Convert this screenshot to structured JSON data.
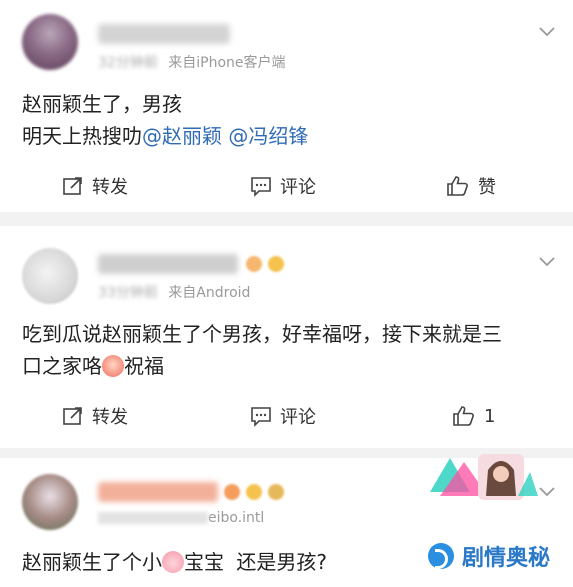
{
  "posts": [
    {
      "time": "32分钟前",
      "source": "来自iPhone客户端",
      "text_line1": "赵丽颖生了，男孩",
      "text_line2_prefix": "明天上热搜叻",
      "mention1": "@赵丽颖",
      "mention2": "@冯绍锋",
      "repost_label": "转发",
      "comment_label": "评论",
      "like_label": "赞"
    },
    {
      "time": "33分钟前",
      "source": "来自Android",
      "text_line1": "吃到瓜说赵丽颖生了个男孩，好幸福呀，接下来就是三",
      "text_line2_prefix": "口之家咯",
      "text_line2_suffix": "祝福",
      "repost_label": "转发",
      "comment_label": "评论",
      "like_count": "1"
    },
    {
      "source_suffix": "eibo.intl",
      "text_prefix": "赵丽颖生了个小",
      "text_middle": "宝宝",
      "text_suffix": "还是男孩?"
    }
  ],
  "watermark": {
    "text": "剧情奥秘"
  },
  "colors": {
    "mention": "#2f6cb5",
    "logo": "#2a78c8",
    "divider": "#f2f2f2"
  },
  "icons": [
    "chevron-down-icon",
    "repost-icon",
    "comment-icon",
    "like-icon",
    "emoji-face-icon",
    "emoji-pig-icon"
  ]
}
